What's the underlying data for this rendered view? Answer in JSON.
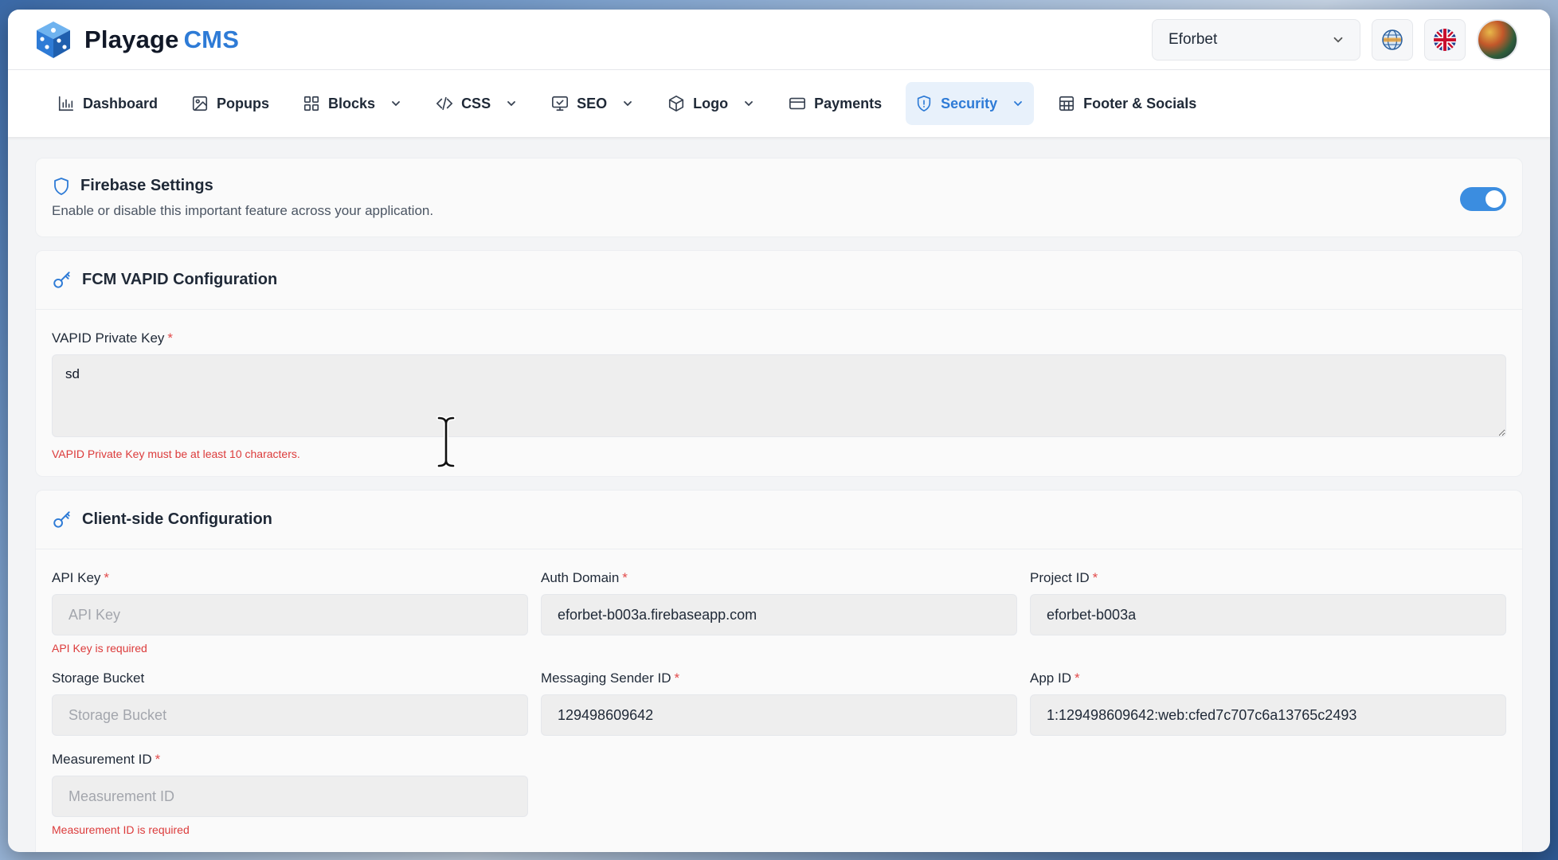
{
  "app": {
    "brand": "Playage",
    "brand_suffix": "CMS",
    "site_selector": "Eforbet"
  },
  "nav": {
    "items": [
      {
        "label": "Dashboard",
        "icon": "bar-chart-icon",
        "dropdown": false
      },
      {
        "label": "Popups",
        "icon": "image-icon",
        "dropdown": false
      },
      {
        "label": "Blocks",
        "icon": "grid-icon",
        "dropdown": true
      },
      {
        "label": "CSS",
        "icon": "code-icon",
        "dropdown": true
      },
      {
        "label": "SEO",
        "icon": "monitor-icon",
        "dropdown": true
      },
      {
        "label": "Logo",
        "icon": "box-icon",
        "dropdown": true
      },
      {
        "label": "Payments",
        "icon": "card-icon",
        "dropdown": false
      },
      {
        "label": "Security",
        "icon": "shield-icon",
        "dropdown": true,
        "active": true
      },
      {
        "label": "Footer & Socials",
        "icon": "layout-icon",
        "dropdown": false
      }
    ]
  },
  "firebase": {
    "title": "Firebase Settings",
    "description": "Enable or disable this important feature across your application.",
    "enabled": true
  },
  "vapid": {
    "title": "FCM VAPID Configuration",
    "private_key_label": "VAPID Private Key",
    "private_key_value": "sd",
    "private_key_error": "VAPID Private Key must be at least 10 characters."
  },
  "client": {
    "title": "Client-side Configuration",
    "api_key": {
      "label": "API Key",
      "value": "",
      "placeholder": "API Key",
      "error": "API Key is required"
    },
    "auth_domain": {
      "label": "Auth Domain",
      "value": "eforbet-b003a.firebaseapp.com"
    },
    "project_id": {
      "label": "Project ID",
      "value": "eforbet-b003a"
    },
    "storage_bucket": {
      "label": "Storage Bucket",
      "value": "",
      "placeholder": "Storage Bucket"
    },
    "messaging_sender_id": {
      "label": "Messaging Sender ID",
      "value": "129498609642"
    },
    "app_id": {
      "label": "App ID",
      "value": "1:129498609642:web:cfed7c707c6a13765c2493"
    },
    "measurement_id": {
      "label": "Measurement ID",
      "value": "",
      "placeholder": "Measurement ID",
      "error": "Measurement ID is required"
    }
  },
  "colors": {
    "accent": "#2e7bd6",
    "error": "#dc3b3b",
    "required": "#e24b4b"
  }
}
